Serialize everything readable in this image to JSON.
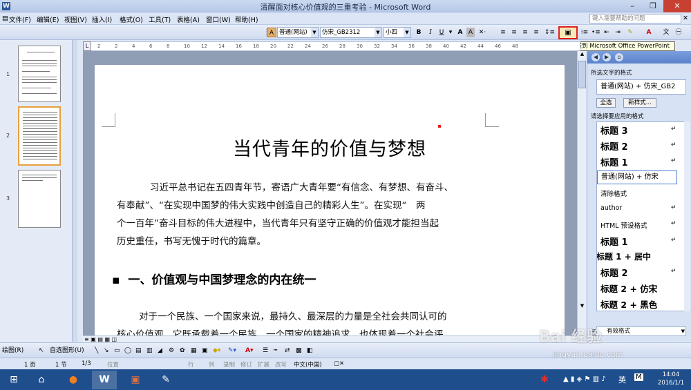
{
  "window": {
    "title": "清醒面对核心价值观的三重考验 - Microsoft Word",
    "app_icon": "W"
  },
  "menu": {
    "items": [
      "文件(F)",
      "编辑(E)",
      "视图(V)",
      "插入(I)",
      "格式(O)",
      "工具(T)",
      "表格(A)",
      "窗口(W)",
      "帮助(H)"
    ],
    "help_placeholder": "键入需要帮助的问题"
  },
  "toolbar": {
    "style_value": "普通(网站)",
    "font_value": "仿宋_GB2312",
    "size_value": "小四",
    "bold": "B",
    "italic": "I",
    "underline": "U",
    "send_ppt_icon": "presentation-icon"
  },
  "tooltip": "发送到 Microsoft Office PowerPoint",
  "ruler": {
    "ticks": [
      "2",
      "2",
      "4",
      "6",
      "8",
      "10",
      "12",
      "14",
      "16",
      "18",
      "20",
      "22",
      "24",
      "26",
      "28",
      "30",
      "32",
      "34",
      "36",
      "38",
      "40",
      "42",
      "44",
      "46",
      "48"
    ]
  },
  "thumbnails": {
    "pages": [
      "1",
      "2",
      "3"
    ],
    "selected": 2
  },
  "document": {
    "title": "当代青年的价值与梦想",
    "para1": [
      "习近平总书记在五四青年节，寄语广大青年要“有信念、有梦想、有奋斗、",
      "有奉献”、“在实现中国梦的伟大实践中创造自己的精彩人生”。在实现“　两",
      "个一百年”奋斗目标的伟大进程中，当代青年只有坚守正确的价值观才能担当起",
      "历史重任，书写无愧于时代的篇章。"
    ],
    "heading1": "一、价值观与中国梦理念的内在统一",
    "para2": [
      "对于一个民族、一个国家来说，最持久、最深层的力量是全社会共同认可的",
      "核心价值观。它既承载着一个民族、一个国家的精神追求，也体现着一个社会评"
    ]
  },
  "taskpane": {
    "selected_label": "所选文字的格式",
    "selected_format": "普通(网站) + 仿宋_GB2",
    "select_all": "全选",
    "new_style": "新样式...",
    "apply_label": "请选择要应用的格式",
    "styles": [
      {
        "name": "标题 3",
        "ret": "↵"
      },
      {
        "name": "标题 2",
        "ret": "↵"
      },
      {
        "name": "标题 1",
        "ret": "↵"
      },
      {
        "name": "普通(网站) + 仿宋",
        "ret": ""
      },
      {
        "name": "清除格式",
        "ret": ""
      },
      {
        "name": "author",
        "ret": "↵"
      },
      {
        "name": "HTML 预设格式",
        "ret": "↵"
      },
      {
        "name": "标题 1",
        "ret": "↵"
      },
      {
        "name": "标题 1 + 居中",
        "ret": ""
      },
      {
        "name": "标题 2",
        "ret": "↵"
      },
      {
        "name": "标题 2 + 仿宋",
        "ret": ""
      },
      {
        "name": "标题 2 + 黑色",
        "ret": ""
      }
    ],
    "show_label": "显示:",
    "show_value": "有效格式"
  },
  "drawbar": {
    "draw": "绘图(R)",
    "autoshapes": "自选图形(U)"
  },
  "status": {
    "page": "1 页",
    "section": "1 节",
    "pages": "1/3",
    "position": "位置",
    "line": "行",
    "column": "列",
    "rec": "录制",
    "trk": "修订",
    "ext": "扩展",
    "ovr": "改写",
    "language": "中文(中国)"
  },
  "taskbar": {
    "time": "14:04",
    "date": "2016/1/1",
    "ime": "英",
    "ime_mode": "M"
  },
  "watermark": {
    "text": "Bai 经验",
    "url": "jingyan.baidu.com"
  },
  "colors": {
    "accent": "#2b579a",
    "highlight_box": "#e02020",
    "taskbar": "#1f4e8c"
  }
}
